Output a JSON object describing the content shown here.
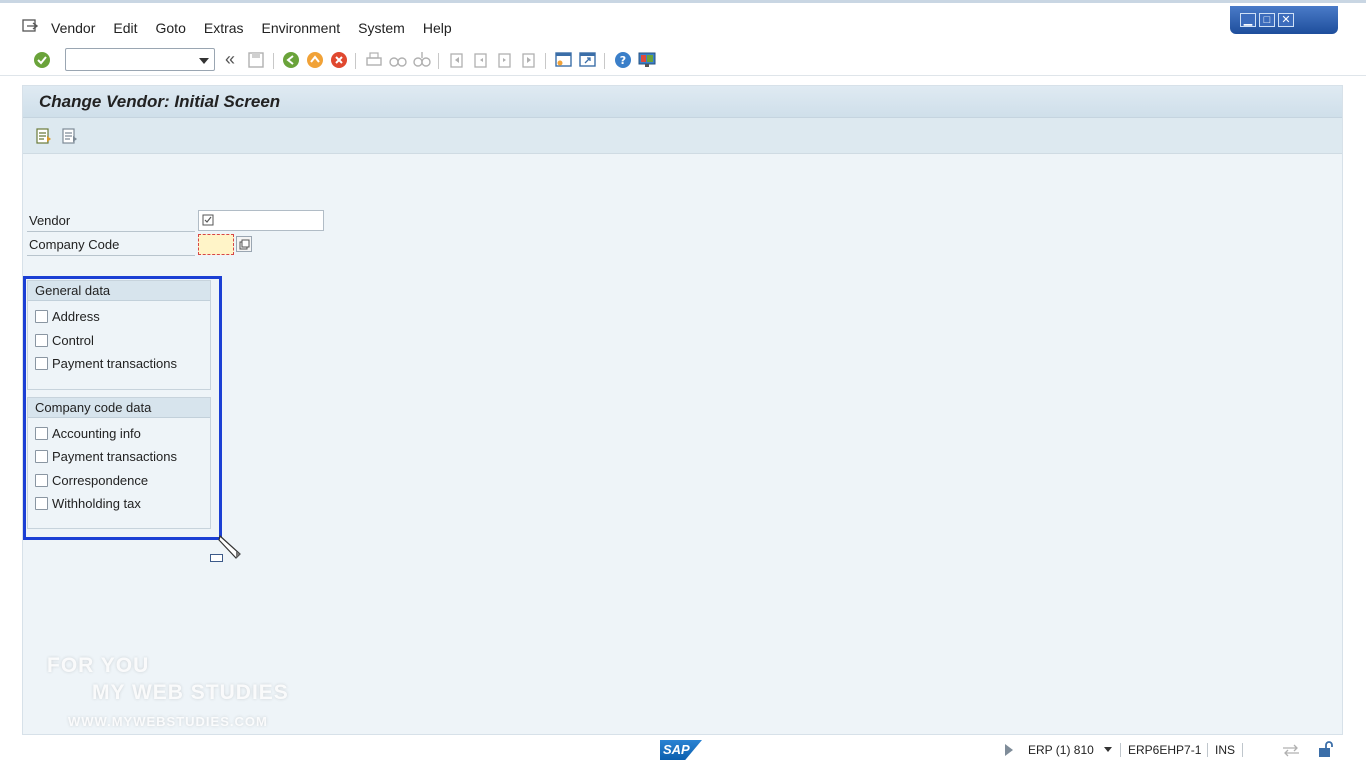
{
  "menu": {
    "items": [
      {
        "label": "Vendor"
      },
      {
        "label": "Edit"
      },
      {
        "label": "Goto"
      },
      {
        "label": "Extras"
      },
      {
        "label": "Environment"
      },
      {
        "label": "System"
      },
      {
        "label": "Help"
      }
    ]
  },
  "toolbar": {
    "command_field_value": "",
    "back_glyph": "«"
  },
  "screen": {
    "title": "Change Vendor:  Initial Screen",
    "fields": {
      "vendor_label": "Vendor",
      "vendor_value": "",
      "company_code_label": "Company Code",
      "company_code_value": ""
    },
    "general_data": {
      "heading": "General data",
      "options": [
        {
          "label": "Address",
          "checked": false
        },
        {
          "label": "Control",
          "checked": false
        },
        {
          "label": "Payment transactions",
          "checked": false
        }
      ]
    },
    "company_code_data": {
      "heading": "Company code data",
      "options": [
        {
          "label": "Accounting info",
          "checked": false
        },
        {
          "label": "Payment transactions",
          "checked": false
        },
        {
          "label": "Correspondence",
          "checked": false
        },
        {
          "label": "Withholding tax",
          "checked": false
        }
      ]
    }
  },
  "watermark": {
    "line1": "FOR YOU",
    "line2": "MY WEB STUDIES",
    "line3": "WWW.MYWEBSTUDIES.COM"
  },
  "status": {
    "logo": "SAP",
    "system": "ERP (1) 810",
    "server": "ERP6EHP7-1",
    "mode": "INS"
  },
  "colors": {
    "highlight_border": "#1b3fd4",
    "screen_bg": "#eef4f8",
    "required_field_bg": "#fff4c8"
  }
}
